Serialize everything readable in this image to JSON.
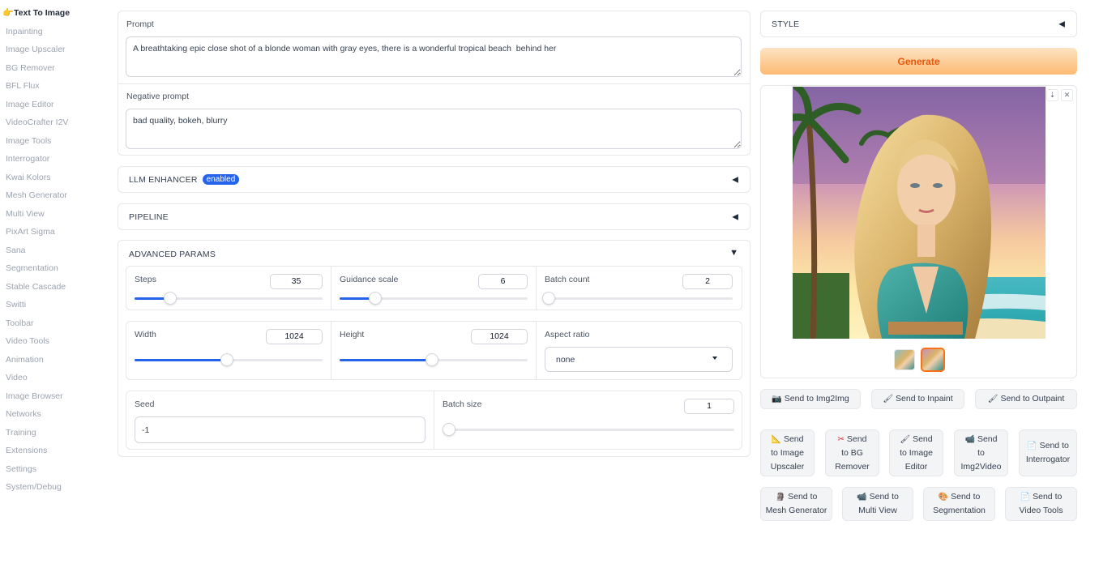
{
  "sidebar": {
    "items": [
      {
        "label": "Text To Image",
        "active": true
      },
      {
        "label": "Inpainting"
      },
      {
        "label": "Image Upscaler"
      },
      {
        "label": "BG Remover"
      },
      {
        "label": "BFL Flux"
      },
      {
        "label": "Image Editor"
      },
      {
        "label": "VideoCrafter I2V"
      },
      {
        "label": "Image Tools"
      },
      {
        "label": "Interrogator"
      },
      {
        "label": "Kwai Kolors"
      },
      {
        "label": "Mesh Generator"
      },
      {
        "label": "Multi View"
      },
      {
        "label": "PixArt Sigma"
      },
      {
        "label": "Sana"
      },
      {
        "label": "Segmentation"
      },
      {
        "label": "Stable Cascade"
      },
      {
        "label": "Switti"
      },
      {
        "label": "Toolbar"
      },
      {
        "label": "Video Tools"
      },
      {
        "label": "Animation"
      },
      {
        "label": "Video"
      },
      {
        "label": "Image Browser"
      },
      {
        "label": "Networks"
      },
      {
        "label": "Training"
      },
      {
        "label": "Extensions"
      },
      {
        "label": "Settings"
      },
      {
        "label": "System/Debug"
      }
    ]
  },
  "prompt": {
    "label": "Prompt",
    "value": "A breathtaking epic close shot of a blonde woman with gray eyes, there is a wonderful tropical beach  behind her"
  },
  "negative_prompt": {
    "label": "Negative prompt",
    "value": "bad quality, bokeh, blurry"
  },
  "accordions": {
    "llm": {
      "title": "LLM ENHANCER",
      "badge": "enabled"
    },
    "pipeline": {
      "title": "PIPELINE"
    },
    "advanced": {
      "title": "ADVANCED PARAMS"
    }
  },
  "params": {
    "steps": {
      "label": "Steps",
      "value": "35",
      "fraction": 0.19
    },
    "guidance": {
      "label": "Guidance scale",
      "value": "6",
      "fraction": 0.19
    },
    "batch_count": {
      "label": "Batch count",
      "value": "2",
      "fraction": 0.02
    },
    "width": {
      "label": "Width",
      "value": "1024",
      "fraction": 0.49
    },
    "height": {
      "label": "Height",
      "value": "1024",
      "fraction": 0.49
    },
    "aspect": {
      "label": "Aspect ratio",
      "value": "none"
    },
    "seed": {
      "label": "Seed",
      "value": "-1"
    },
    "batch_size": {
      "label": "Batch size",
      "value": "1",
      "fraction": 0.0
    }
  },
  "style": {
    "title": "STYLE"
  },
  "generate": {
    "label": "Generate"
  },
  "gallery": {
    "thumbnails": 2,
    "selected": 2
  },
  "send_buttons": {
    "row1": [
      {
        "icon": "📷",
        "label": "Send to Img2Img"
      },
      {
        "icon": "🖌",
        "label": "Send to Inpaint"
      },
      {
        "icon": "🖌",
        "label": "Send to Outpaint"
      }
    ],
    "row2": [
      {
        "icon": "📐",
        "l1": "Send",
        "l2": "to Image",
        "l3": "Upscaler"
      },
      {
        "icon": "✂",
        "l1": "Send",
        "l2": "to BG",
        "l3": "Remover"
      },
      {
        "icon": "🖌",
        "l1": "Send",
        "l2": "to Image",
        "l3": "Editor"
      },
      {
        "icon": "📹",
        "l1": "Send",
        "l2": "to",
        "l3": "Img2Video"
      },
      {
        "icon": "📄",
        "l1": "Send to",
        "l2": "Interrogator"
      }
    ],
    "row3": [
      {
        "icon": "🗿",
        "l1": "Send to",
        "l2": "Mesh Generator"
      },
      {
        "icon": "📹",
        "l1": "Send to",
        "l2": "Multi View"
      },
      {
        "icon": "🎨",
        "l1": "Send to",
        "l2": "Segmentation"
      },
      {
        "icon": "📄",
        "l1": "Send to",
        "l2": "Video Tools"
      }
    ]
  },
  "colors": {
    "accent": "#2563eb",
    "generate_from": "#fde3c2",
    "generate_to": "#fdba74",
    "generate_text": "#ea580c"
  },
  "icons": {
    "active_nav": "pointing-hand-icon",
    "collapsed": "triangle-left-icon",
    "expanded": "triangle-down-icon",
    "dropdown": "caret-down-icon",
    "download": "download-icon",
    "close": "close-icon"
  }
}
